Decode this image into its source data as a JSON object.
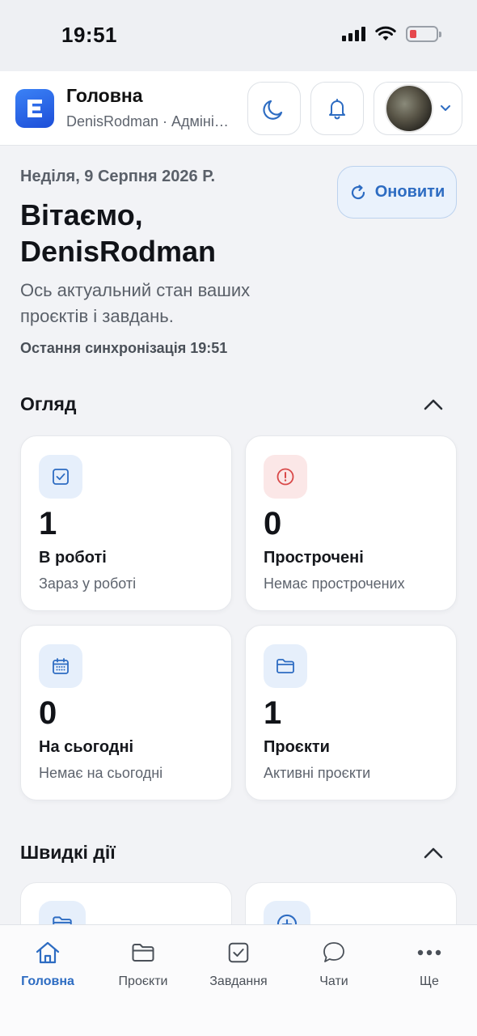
{
  "status_bar": {
    "time": "19:51"
  },
  "header": {
    "title": "Головна",
    "subtitle": "DenisRodman · Адміністратор"
  },
  "hero": {
    "date": "Неділя, 9 Серпня 2026 Р.",
    "greeting_line1": "Вітаємо,",
    "greeting_line2": "DenisRodman",
    "description": "Ось актуальний стан ваших проєктів і завдань.",
    "sync": "Остання синхронізація 19:51",
    "refresh_label": "Оновити"
  },
  "overview": {
    "title": "Огляд",
    "cards": [
      {
        "value": "1",
        "label": "В роботі",
        "desc": "Зараз у роботі",
        "icon": "checkbox-icon"
      },
      {
        "value": "0",
        "label": "Прострочені",
        "desc": "Немає прострочених",
        "icon": "alert-circle-icon"
      },
      {
        "value": "0",
        "label": "На сьогодні",
        "desc": "Немає на сьогодні",
        "icon": "calendar-icon"
      },
      {
        "value": "1",
        "label": "Проєкти",
        "desc": "Активні проєкти",
        "icon": "folder-icon"
      }
    ]
  },
  "quick_actions": {
    "title": "Швидкі дії"
  },
  "tabs": [
    {
      "label": "Головна",
      "icon": "home-icon",
      "active": true
    },
    {
      "label": "Проєкти",
      "icon": "folder-icon",
      "active": false
    },
    {
      "label": "Завдання",
      "icon": "checkbox-icon",
      "active": false
    },
    {
      "label": "Чати",
      "icon": "chat-icon",
      "active": false
    },
    {
      "label": "Ще",
      "icon": "more-icon",
      "active": false
    }
  ],
  "colors": {
    "accent": "#2d6cc2",
    "danger": "#d94848",
    "background": "#f2f3f6"
  }
}
